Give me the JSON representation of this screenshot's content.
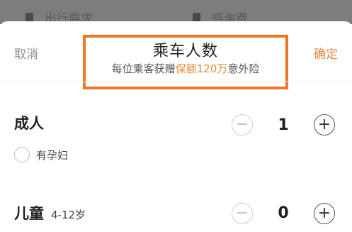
{
  "background": {
    "left_item": "出行要求",
    "right_item": "感谢费"
  },
  "header": {
    "cancel_label": "取消",
    "confirm_label": "确定",
    "title": "乘车人数",
    "subtitle_prefix": "每位乘客获赠",
    "subtitle_highlight": "保额120万",
    "subtitle_suffix": "意外险"
  },
  "adult": {
    "label": "成人",
    "count": "1",
    "minus": "−",
    "plus": "+",
    "pregnant_label": "有孕妇"
  },
  "child": {
    "label": "儿童",
    "age_range": "4-12岁",
    "count": "0",
    "minus": "−",
    "plus": "+"
  },
  "colors": {
    "accent": "#e38a3e",
    "highlight_box": "#f07526"
  }
}
